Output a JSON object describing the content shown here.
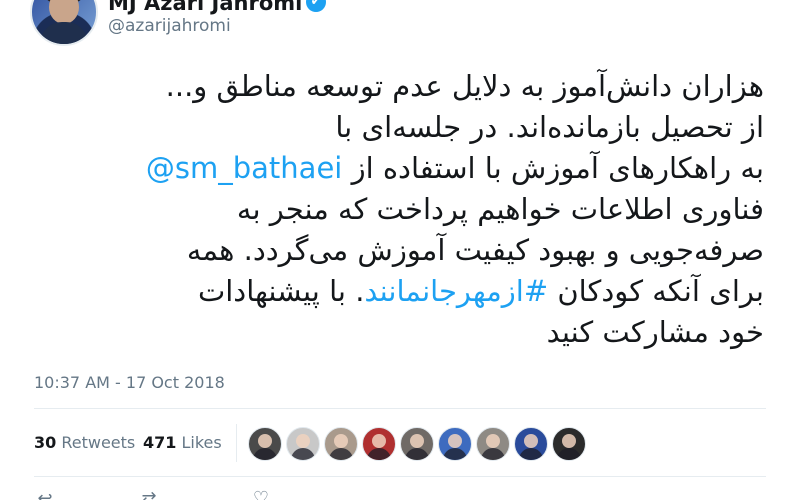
{
  "header": {
    "display_name": "MJ Azari Jahromi",
    "verified_label": "✔",
    "username": "@azarijahromi"
  },
  "tweet": {
    "lines": [
      {
        "text": "هزاران دانش‌آموز به دلایل عدم توسعه مناطق و..."
      },
      {
        "text": "از تحصیل بازمانده‌اند. در جلسه‌ای با"
      },
      {
        "before": "",
        "link": "@sm_bathaei",
        "after": " به راهکارهای آموزش با استفاده از"
      },
      {
        "text": "فناوری اطلاعات خواهیم پرداخت که منجر به"
      },
      {
        "text": "صرفه‌جویی و بهبود کیفیت آموزش می‌گردد. همه"
      },
      {
        "before": "برای آنکه کودکان ",
        "link": "#ازمهرجانمانند",
        "after": ". با پیشنهادات"
      },
      {
        "text": "خود مشارکت کنید"
      }
    ],
    "timestamp": "10:37 AM - 17 Oct 2018"
  },
  "stats": {
    "retweets_count": "30",
    "retweets_label": " Retweets",
    "likes_count": "471",
    "likes_label": " Likes"
  },
  "likers": [
    {
      "name": "liker-avatar-1",
      "color": "#4a4a4a"
    },
    {
      "name": "liker-avatar-2",
      "color": "#c8c8c8"
    },
    {
      "name": "liker-avatar-3",
      "color": "#a99a8c"
    },
    {
      "name": "liker-avatar-4",
      "color": "#b03030"
    },
    {
      "name": "liker-avatar-5",
      "color": "#6f6a66"
    },
    {
      "name": "liker-avatar-6",
      "color": "#3d6bbf"
    },
    {
      "name": "liker-avatar-7",
      "color": "#8e8a84"
    },
    {
      "name": "liker-avatar-8",
      "color": "#2a4b9b"
    },
    {
      "name": "liker-avatar-9",
      "color": "#2b2b2b"
    }
  ],
  "actions": {
    "reply_icon": "reply-icon",
    "retweet_icon": "retweet-icon",
    "like_icon": "heart-icon"
  },
  "colors": {
    "link": "#1da1f2",
    "text": "#14171a",
    "muted": "#657786"
  }
}
